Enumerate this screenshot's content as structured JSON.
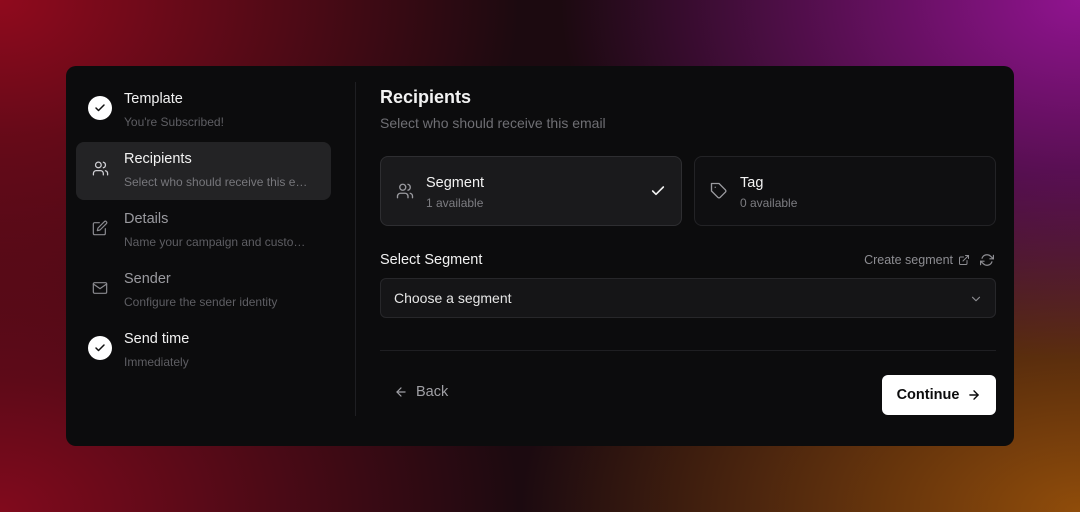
{
  "sidebar": {
    "steps": [
      {
        "title": "Template",
        "subtitle": "You're Subscribed!",
        "state": "done",
        "icon": "check-icon"
      },
      {
        "title": "Recipients",
        "subtitle": "Select who should receive this e…",
        "state": "active",
        "icon": "users-icon"
      },
      {
        "title": "Details",
        "subtitle": "Name your campaign and custo…",
        "state": "pending",
        "icon": "edit-icon"
      },
      {
        "title": "Sender",
        "subtitle": "Configure the sender identity",
        "state": "pending",
        "icon": "mail-icon"
      },
      {
        "title": "Send time",
        "subtitle": "Immediately",
        "state": "done",
        "icon": "check-icon"
      }
    ]
  },
  "main": {
    "title": "Recipients",
    "subtitle": "Select who should receive this email",
    "options": [
      {
        "title": "Segment",
        "subtitle": "1 available",
        "selected": true,
        "icon": "users-icon"
      },
      {
        "title": "Tag",
        "subtitle": "0 available",
        "selected": false,
        "icon": "tag-icon"
      }
    ],
    "field_label": "Select Segment",
    "create_link": "Create segment",
    "select_placeholder": "Choose a segment"
  },
  "footer": {
    "back_label": "Back",
    "continue_label": "Continue"
  },
  "colors": {
    "card_bg": "#0c0c0d",
    "active_step_bg": "#232325",
    "primary_button_bg": "#ffffff"
  }
}
